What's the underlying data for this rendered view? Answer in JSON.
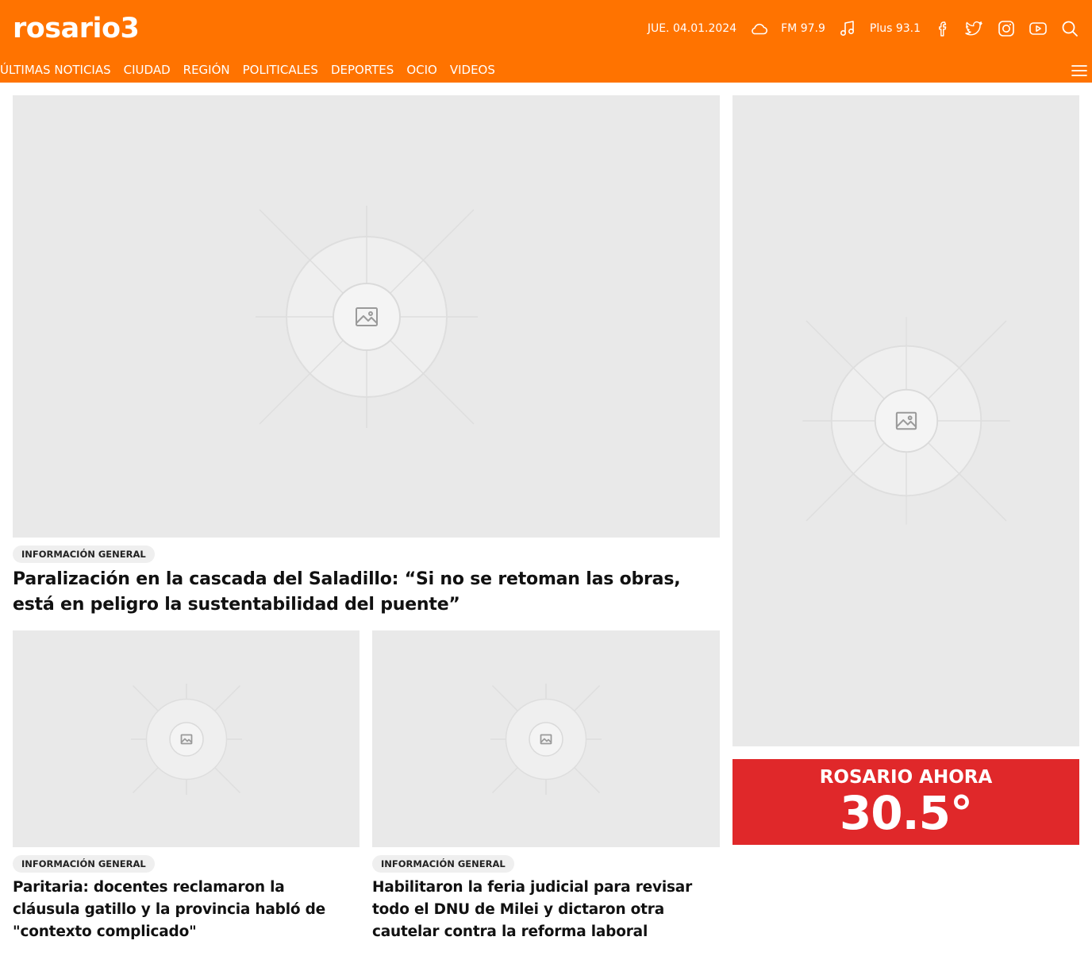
{
  "header": {
    "logo": "rosario3",
    "date": "JUE. 04.01.2024",
    "radio_fm": "FM 97.9",
    "radio_plus": "Plus 93.1",
    "icons": [
      "cloud-icon",
      "music-note-icon",
      "facebook-icon",
      "twitter-icon",
      "instagram-icon",
      "youtube-icon",
      "search-icon"
    ]
  },
  "nav": {
    "items": [
      "ÚLTIMAS NOTICIAS",
      "CIUDAD",
      "REGIÓN",
      "POLITICALES",
      "DEPORTES",
      "OCIO",
      "VIDEOS"
    ],
    "menu_icon": "hamburger-menu-icon"
  },
  "main_story": {
    "category": "INFORMACIÓN GENERAL",
    "headline": "Paralización en la cascada del Saladillo: “Si no se retoman las obras, está en peligro la sustentabilidad del puente”"
  },
  "stories": [
    {
      "category": "INFORMACIÓN GENERAL",
      "headline": "Paritaria: docentes reclamaron la cláusula gatillo y la provincia habló de \"contexto complicado\""
    },
    {
      "category": "INFORMACIÓN GENERAL",
      "headline": "Habilitaron la feria judicial para revisar todo el DNU de Milei y dictaron otra cautelar contra la reforma laboral"
    }
  ],
  "weather": {
    "label": "ROSARIO AHORA",
    "temperature": "30.5°"
  },
  "colors": {
    "brand": "#ff7300",
    "weather_bg": "#e0282a",
    "placeholder": "#e9e9e9"
  }
}
